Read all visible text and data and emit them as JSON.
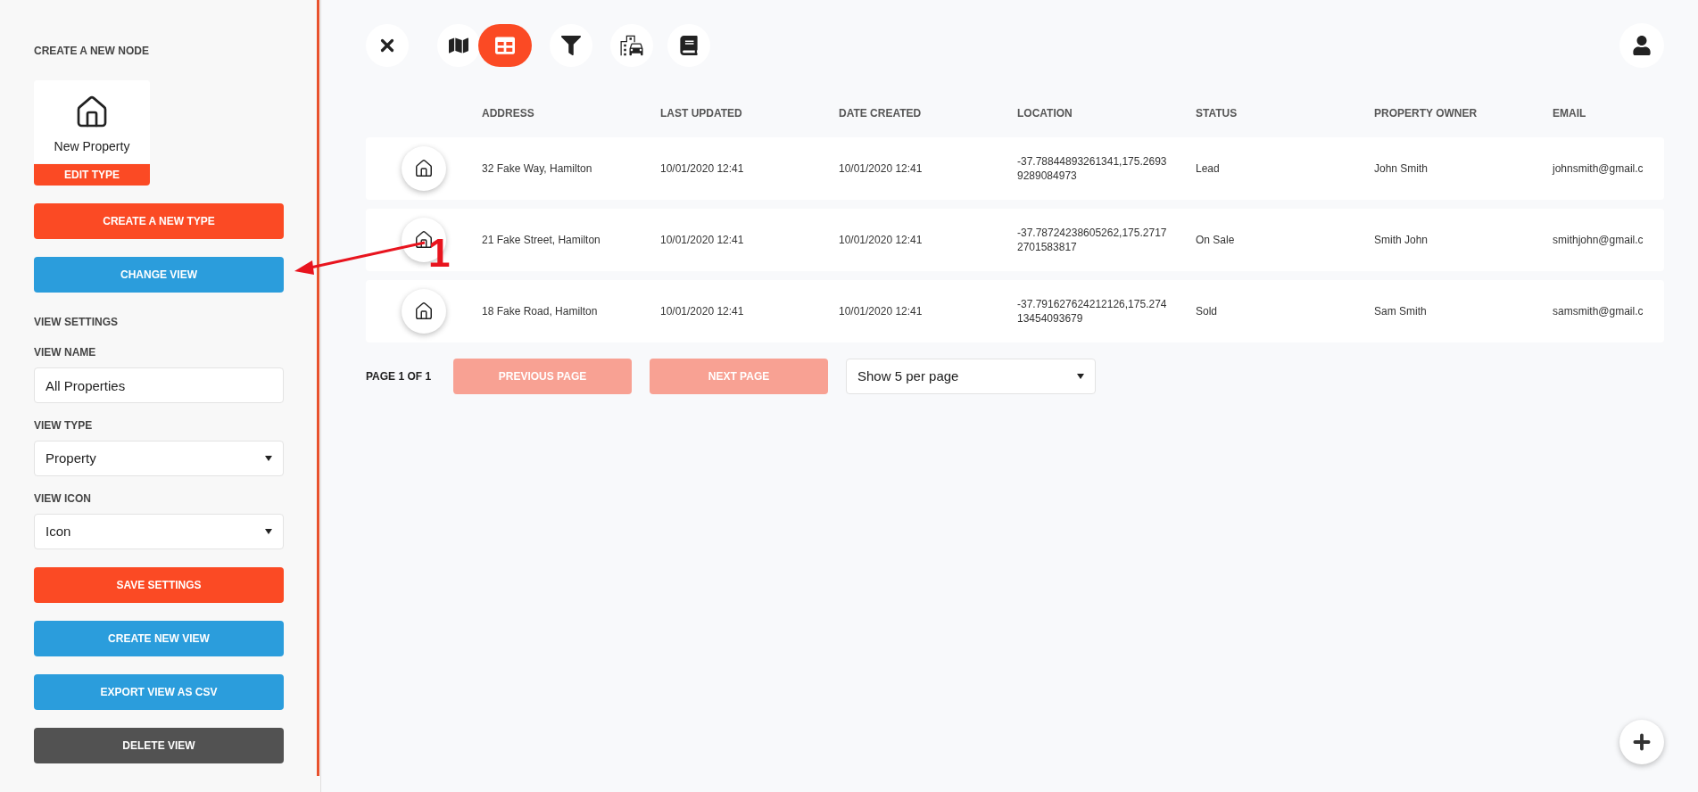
{
  "sidebar": {
    "items": [
      {
        "kind": "heading",
        "text": "CREATE A NEW NODE"
      },
      {
        "kind": "node",
        "label": "New Property",
        "button": "EDIT TYPE"
      },
      {
        "kind": "accent",
        "label": "CREATE A NEW TYPE"
      },
      {
        "kind": "info",
        "label": "CHANGE VIEW"
      },
      {
        "kind": "heading",
        "text": "VIEW SETTINGS"
      },
      {
        "kind": "input",
        "label": "VIEW NAME",
        "value": "All Properties"
      },
      {
        "kind": "select",
        "label": "VIEW TYPE",
        "value": "Property"
      },
      {
        "kind": "select",
        "label": "VIEW ICON",
        "value": "Icon"
      },
      {
        "kind": "accent",
        "label": "SAVE SETTINGS"
      },
      {
        "kind": "info",
        "label": "CREATE NEW VIEW"
      },
      {
        "kind": "info",
        "label": "EXPORT VIEW AS CSV"
      },
      {
        "kind": "dark",
        "label": "DELETE VIEW"
      }
    ]
  },
  "toolbar": {
    "tools": [
      {
        "selected": false
      },
      {
        "selected": false
      },
      {
        "selected": true
      },
      {
        "selected": false
      },
      {
        "selected": false
      },
      {
        "selected": false
      }
    ]
  },
  "table": {
    "columns": [
      "ADDRESS",
      "LAST UPDATED",
      "DATE CREATED",
      "LOCATION",
      "STATUS",
      "PROPERTY OWNER",
      "EMAIL"
    ],
    "rows": [
      {
        "cells": [
          "32 Fake Way, Hamilton",
          "10/01/2020 12:41",
          "10/01/2020 12:41",
          "-37.78844893261341,175.26939289084973",
          "Lead",
          "John Smith",
          "johnsmith@gmail.c"
        ]
      },
      {
        "cells": [
          "21 Fake Street, Hamilton",
          "10/01/2020 12:41",
          "10/01/2020 12:41",
          "-37.78724238605262,175.27172701583817",
          "On Sale",
          "Smith John",
          "smithjohn@gmail.c"
        ]
      },
      {
        "cells": [
          "18 Fake Road, Hamilton",
          "10/01/2020 12:41",
          "10/01/2020 12:41",
          "-37.791627624212126,175.27413454093679",
          "Sold",
          "Sam Smith",
          "samsmith@gmail.c"
        ]
      }
    ]
  },
  "pagination": {
    "label": "PAGE 1 OF 1",
    "previous": {
      "label": "PREVIOUS PAGE",
      "disabled": true
    },
    "next": {
      "label": "NEXT PAGE",
      "disabled": true
    },
    "per_page": "Show 5 per page"
  },
  "annotation": {
    "label": "1"
  }
}
